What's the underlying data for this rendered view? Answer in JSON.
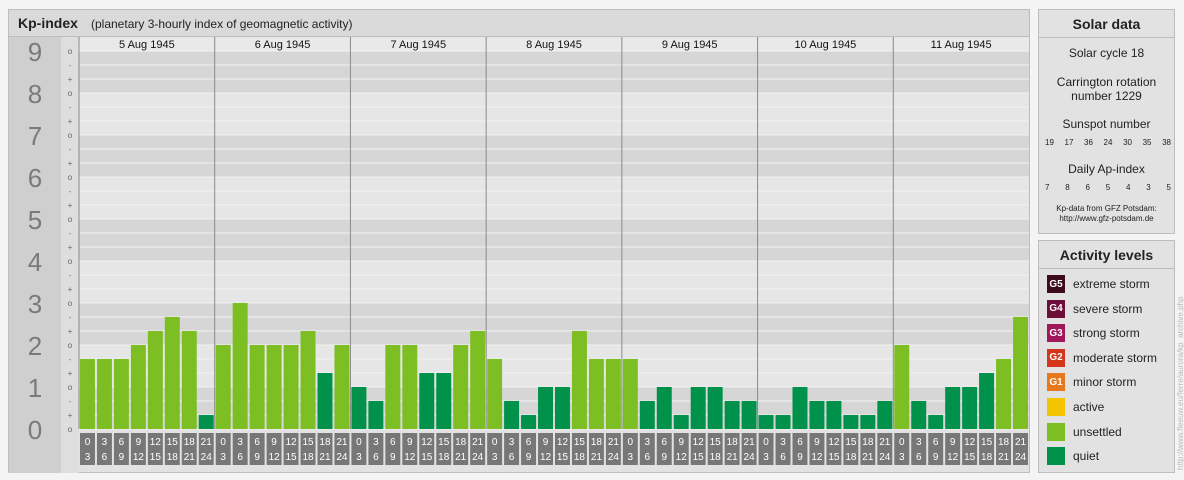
{
  "header": {
    "title": "Kp-index",
    "subtitle": "(planetary 3-hourly index of geomagnetic activity)"
  },
  "chart_data": {
    "type": "bar",
    "ylim": [
      0,
      9
    ],
    "y_major_labels": [
      "0",
      "1",
      "2",
      "3",
      "4",
      "5",
      "6",
      "7",
      "8",
      "9"
    ],
    "y_minor_labels": [
      "o",
      "+",
      "-",
      "o",
      "+",
      "-",
      "o",
      "+",
      "-",
      "o",
      "+",
      "-",
      "o",
      "+",
      "-",
      "o",
      "+",
      "-",
      "o",
      "+",
      "-",
      "o",
      "+",
      "-",
      "o",
      "+",
      "-",
      "o"
    ],
    "days": [
      "5 Aug 1945",
      "6 Aug 1945",
      "7 Aug 1945",
      "8 Aug 1945",
      "9 Aug 1945",
      "10 Aug 1945",
      "11 Aug 1945"
    ],
    "interval_start": [
      "0",
      "3",
      "6",
      "9",
      "12",
      "15",
      "18",
      "21"
    ],
    "interval_end": [
      "3",
      "6",
      "9",
      "12",
      "15",
      "18",
      "21",
      "24"
    ],
    "values": [
      1.667,
      1.667,
      1.667,
      2.0,
      2.333,
      2.667,
      2.333,
      0.333,
      2.0,
      3.0,
      2.0,
      2.0,
      2.0,
      2.333,
      1.333,
      2.0,
      1.0,
      0.667,
      2.0,
      2.0,
      1.333,
      1.333,
      2.0,
      2.333,
      1.667,
      0.667,
      0.333,
      1.0,
      1.0,
      2.333,
      1.667,
      1.667,
      1.667,
      0.667,
      1.0,
      0.333,
      1.0,
      1.0,
      0.667,
      0.667,
      0.333,
      0.333,
      1.0,
      0.667,
      0.667,
      0.333,
      0.333,
      0.667,
      2.0,
      0.667,
      0.333,
      1.0,
      1.0,
      1.333,
      1.667,
      2.667
    ],
    "colors": {
      "quiet": "#00924a",
      "unsettled": "#7dbe22"
    }
  },
  "solar": {
    "title": "Solar data",
    "cycle": "Solar cycle 18",
    "rotation_line1": "Carrington rotation",
    "rotation_line2": "number 1229",
    "sunspot_title": "Sunspot number",
    "sunspot_values": [
      "19",
      "17",
      "36",
      "24",
      "30",
      "35",
      "38"
    ],
    "ap_title": "Daily Ap-index",
    "ap_values": [
      "7",
      "8",
      "6",
      "5",
      "4",
      "3",
      "5"
    ],
    "credit_line1": "Kp-data from GFZ Potsdam:",
    "credit_line2": "http://www.gfz-potsdam.de"
  },
  "activity": {
    "title": "Activity levels",
    "levels": [
      {
        "code": "G5",
        "label": "extreme storm",
        "color": "#3d0a1e"
      },
      {
        "code": "G4",
        "label": "severe storm",
        "color": "#6e0f3a"
      },
      {
        "code": "G3",
        "label": "strong storm",
        "color": "#a0185a"
      },
      {
        "code": "G2",
        "label": "moderate storm",
        "color": "#d4361c"
      },
      {
        "code": "G1",
        "label": "minor storm",
        "color": "#e8781c"
      },
      {
        "code": "",
        "label": "active",
        "color": "#f5c400"
      },
      {
        "code": "",
        "label": "unsettled",
        "color": "#7dbe22"
      },
      {
        "code": "",
        "label": "quiet",
        "color": "#00924a"
      }
    ]
  },
  "watermark": "http://www.fleeuw.eu/ferre/aurora/kp_archive.php"
}
